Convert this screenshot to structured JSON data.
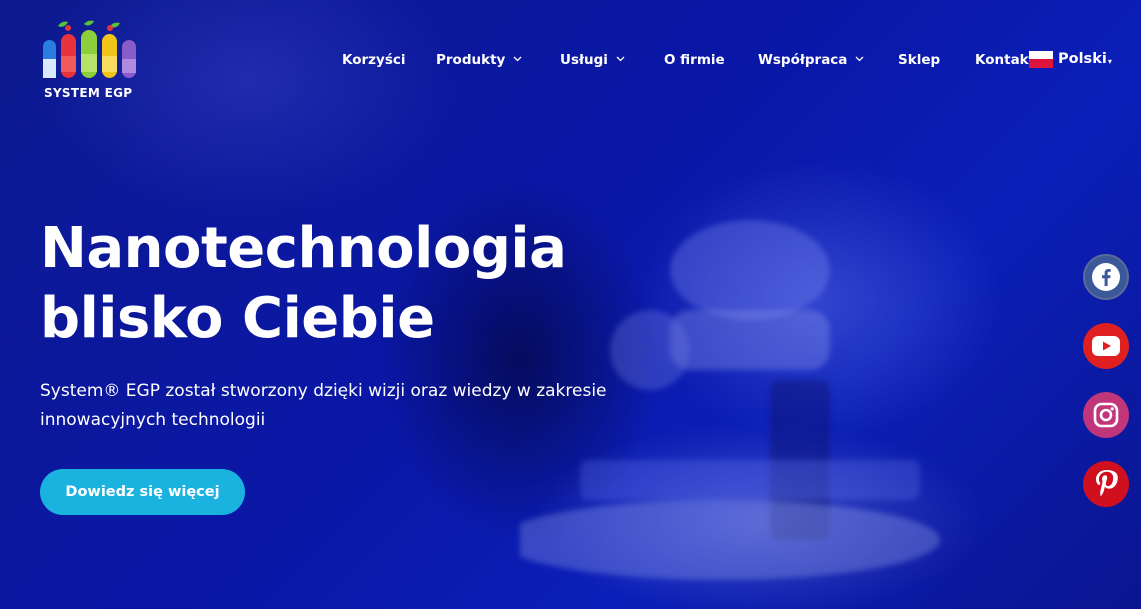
{
  "brand": {
    "name": "SYSTEM EGP"
  },
  "nav": {
    "items": [
      {
        "label": "Korzyści",
        "has_dropdown": false
      },
      {
        "label": "Produkty",
        "has_dropdown": true
      },
      {
        "label": "Usługi",
        "has_dropdown": true
      },
      {
        "label": "O firmie",
        "has_dropdown": false
      },
      {
        "label": "Współpraca",
        "has_dropdown": true
      },
      {
        "label": "Sklep",
        "has_dropdown": false
      },
      {
        "label": "Kontakt",
        "has_dropdown": false
      }
    ],
    "chevron": "⌄"
  },
  "language": {
    "label": "Polski",
    "caret": "▾",
    "flag": "poland-flag"
  },
  "hero": {
    "title_line1": "Nanotechnologia",
    "title_line2": "blisko Ciebie",
    "subtitle_line1": "System® EGP został stworzony dzięki wizji oraz wiedzy w zakresie",
    "subtitle_line2": "innowacyjnych technologii",
    "cta_label": "Dowiedz się więcej"
  },
  "social": [
    {
      "name": "facebook-icon",
      "color": "#3b5998"
    },
    {
      "name": "youtube-icon",
      "color": "#e02020"
    },
    {
      "name": "instagram-icon",
      "color": "#c1357a"
    },
    {
      "name": "pinterest-icon",
      "color": "#d0101e"
    }
  ],
  "colors": {
    "background": "#0b1aa8",
    "cta": "#1ab3e0",
    "text": "#ffffff"
  }
}
